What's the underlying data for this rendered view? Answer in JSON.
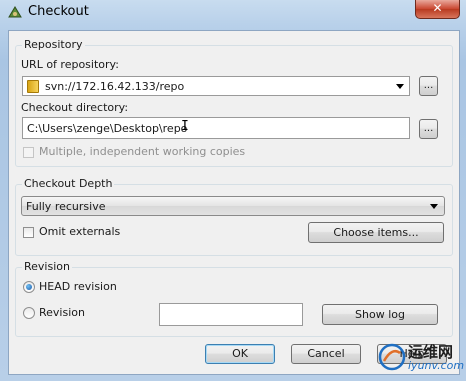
{
  "window": {
    "title": "Checkout",
    "close_label": "✕"
  },
  "repository": {
    "group_title": "Repository",
    "url_label": "URL of repository:",
    "url_value": "svn://172.16.42.133/repo",
    "url_browse_label": "...",
    "dir_label": "Checkout directory:",
    "dir_value": "C:\\Users\\zenge\\Desktop\\repo",
    "dir_browse_label": "...",
    "multiple_label": "Multiple, independent working copies"
  },
  "depth": {
    "group_title": "Checkout Depth",
    "depth_value": "Fully recursive",
    "omit_externals_label": "Omit externals",
    "choose_items_label": "Choose items..."
  },
  "revision": {
    "group_title": "Revision",
    "head_label": "HEAD revision",
    "revision_label": "Revision",
    "revision_value": "",
    "show_log_label": "Show log"
  },
  "footer": {
    "ok_label": "OK",
    "cancel_label": "Cancel",
    "help_label": "Help"
  },
  "watermark": {
    "text": "运维网",
    "sub": "iyunv.com"
  },
  "colors": {
    "accent": "#3c7fb1",
    "title_bg": "#b9d1ea",
    "close": "#c9452f"
  }
}
